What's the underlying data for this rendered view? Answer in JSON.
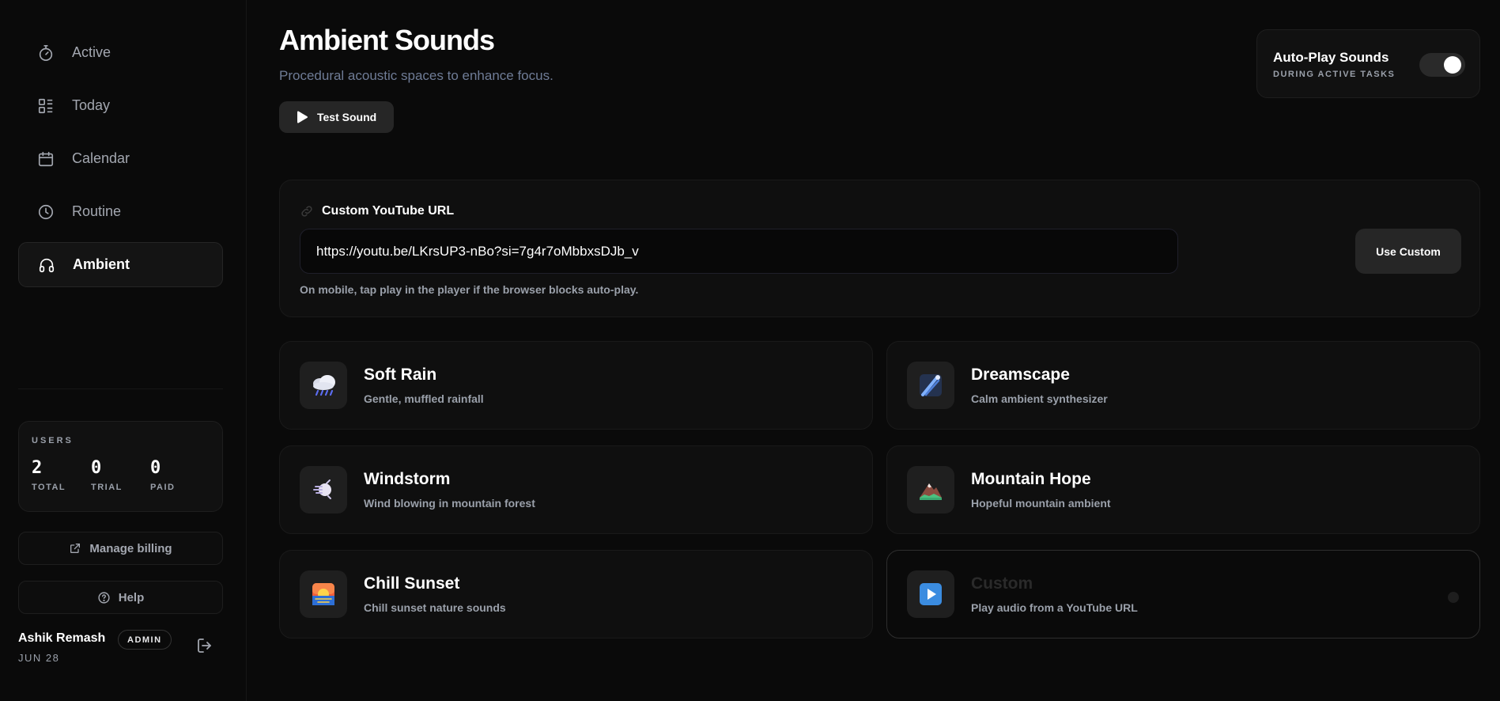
{
  "sidebar": {
    "nav": [
      {
        "label": "Active",
        "icon": "stopwatch-icon"
      },
      {
        "label": "Today",
        "icon": "list-layout-icon"
      },
      {
        "label": "Calendar",
        "icon": "calendar-icon"
      },
      {
        "label": "Routine",
        "icon": "clock-icon"
      },
      {
        "label": "Ambient",
        "icon": "headphones-icon",
        "active": true
      }
    ],
    "users": {
      "title": "USERS",
      "stats": [
        {
          "value": "2",
          "label": "TOTAL"
        },
        {
          "value": "0",
          "label": "TRIAL"
        },
        {
          "value": "0",
          "label": "PAID"
        }
      ]
    },
    "billing_label": "Manage billing",
    "help_label": "Help",
    "user": {
      "name": "Ashik Remash",
      "role": "ADMIN",
      "date": "JUN 28"
    }
  },
  "header": {
    "title": "Ambient Sounds",
    "subtitle": "Procedural acoustic spaces to enhance focus.",
    "test_label": "Test Sound"
  },
  "autoplay": {
    "title": "Auto-Play Sounds",
    "subtitle": "DURING ACTIVE TASKS",
    "enabled": true
  },
  "custom_url": {
    "label": "Custom YouTube URL",
    "value": "https://youtu.be/LKrsUP3-nBo?si=7g4r7oMbbxsDJb_v",
    "button": "Use Custom",
    "hint": "On mobile, tap play in the player if the browser blocks auto-play."
  },
  "sounds": [
    {
      "title": "Soft Rain",
      "subtitle": "Gentle, muffled rainfall",
      "icon": "rain-cloud-icon"
    },
    {
      "title": "Dreamscape",
      "subtitle": "Calm ambient synthesizer",
      "icon": "comet-icon"
    },
    {
      "title": "Windstorm",
      "subtitle": "Wind blowing in mountain forest",
      "icon": "wind-icon"
    },
    {
      "title": "Mountain Hope",
      "subtitle": "Hopeful mountain ambient",
      "icon": "mountain-icon"
    },
    {
      "title": "Chill Sunset",
      "subtitle": "Chill sunset nature sounds",
      "icon": "sunset-icon"
    },
    {
      "title": "Custom",
      "subtitle": "Play audio from a YouTube URL",
      "icon": "play-button-icon"
    }
  ],
  "colors": {
    "background": "#0a0a0a",
    "card": "#0f0f0f",
    "accent_muted": "#6f7c96"
  }
}
